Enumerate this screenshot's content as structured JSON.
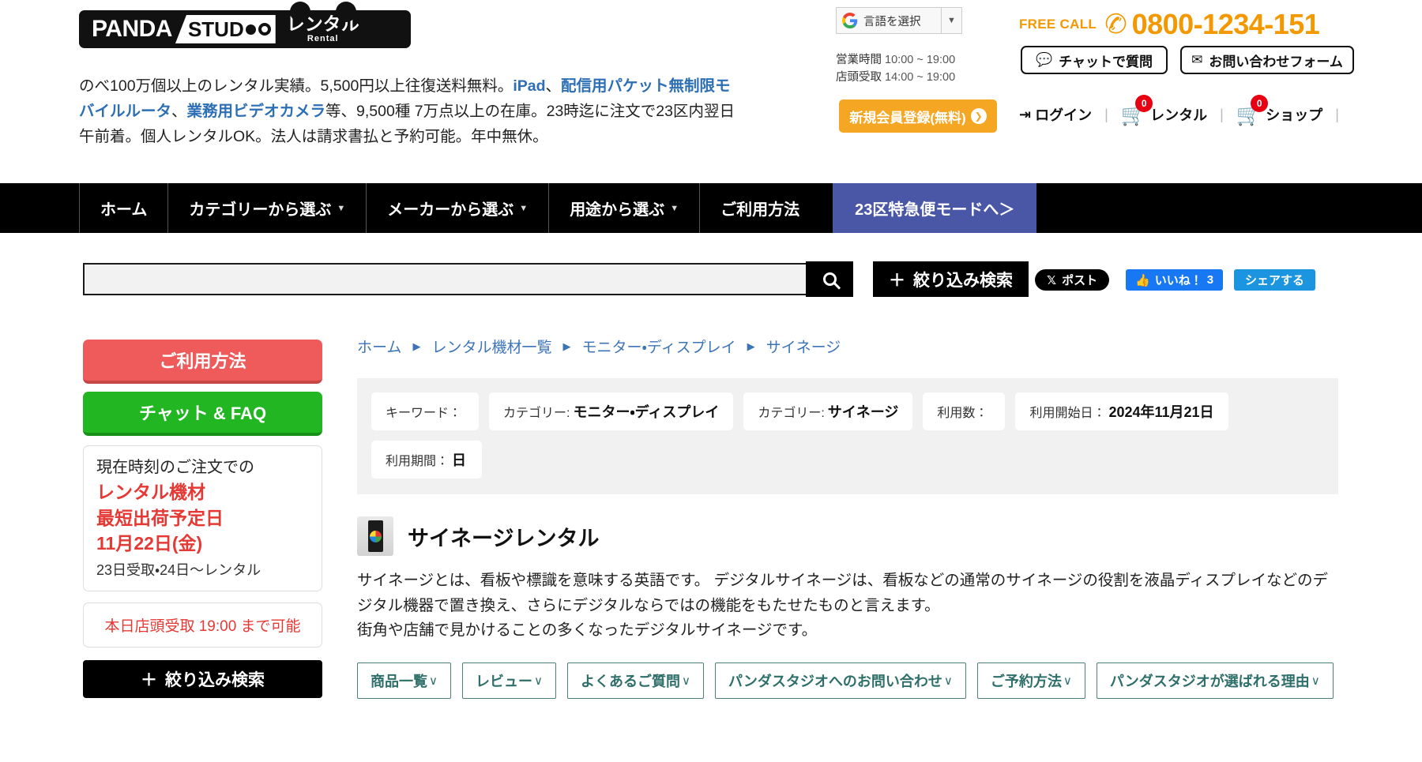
{
  "header": {
    "logo": {
      "panda": "PANDA",
      "studio": "STUD",
      "jp": "レンタル",
      "jp_sub": "Rental"
    },
    "intro_parts": {
      "p1": "のべ100万個以上のレンタル実績。5,500円以上往復送料無料。",
      "link1": "iPad",
      "sep1": "、",
      "link2": "配信用パケット無制限モバイルルータ",
      "sep2": "、",
      "link3": "業務用ビデオカメラ",
      "p2": "等、9,500種 7万点以上の在庫。23時迄に注文で23区内翌日午前着。個人レンタルOK。法人は請求書払と予約可能。年中無休。"
    },
    "language_select": {
      "label": "言語を選択",
      "caret": "▼",
      "icon": "google-g-icon"
    },
    "hours": [
      {
        "label": "営業時間",
        "value": "10:00 ~ 19:00"
      },
      {
        "label": "店頭受取",
        "value": "14:00 ~ 19:00"
      }
    ],
    "free_call": {
      "label": "FREE CALL",
      "number": "0800-1234-151",
      "icon": "phone-icon"
    },
    "chat_button": {
      "label": "チャットで質問",
      "icon": "chat-bubble-icon"
    },
    "contact_button": {
      "label": "お問い合わせフォーム",
      "icon": "envelope-icon"
    },
    "register_button": {
      "label": "新規会員登録(無料)",
      "arrow": "❯"
    },
    "account": {
      "login": {
        "label": "ログイン",
        "icon": "login-arrow-icon"
      },
      "rental_cart": {
        "label": "レンタル",
        "count": "0",
        "icon": "cart-icon"
      },
      "shop_cart": {
        "label": "ショップ",
        "count": "0",
        "icon": "cart-icon"
      },
      "separator": "|"
    }
  },
  "nav": {
    "items": [
      {
        "label": "ホーム",
        "has_caret": false
      },
      {
        "label": "カテゴリーから選ぶ",
        "has_caret": true
      },
      {
        "label": "メーカーから選ぶ",
        "has_caret": true
      },
      {
        "label": "用途から選ぶ",
        "has_caret": true
      },
      {
        "label": "ご利用方法",
        "has_caret": false
      }
    ],
    "caret": "▼",
    "highlight": "23区特急便モードへ＞"
  },
  "search": {
    "value": "",
    "placeholder": "",
    "go_icon": "search-icon",
    "refine_label": "絞り込み検索",
    "refine_plus": "＋"
  },
  "social": {
    "x_post": {
      "label": "ポスト",
      "icon": "x-logo-icon"
    },
    "fb_like": {
      "label": "いいね！",
      "count": "3",
      "icon": "thumbs-up-icon"
    },
    "fb_share": {
      "label": "シェアする"
    }
  },
  "sidebar": {
    "howto_button": "ご利用方法",
    "chat_faq_button": "チャット & FAQ",
    "shipping_card": {
      "line1": "現在時刻のご注文での",
      "line2": "レンタル機材",
      "line3": "最短出荷予定日",
      "line4": "11月22日(金)",
      "line5": "23日受取・24日〜レンタル"
    },
    "pickup_card": "本日店頭受取 19:00 まで可能",
    "refine_button": "絞り込み検索",
    "refine_plus": "＋"
  },
  "main": {
    "breadcrumb": [
      {
        "label": "ホーム"
      },
      {
        "label": "レンタル機材一覧"
      },
      {
        "label": "モニター・ディスプレイ"
      },
      {
        "label": "サイネージ"
      }
    ],
    "breadcrumb_sep": "▶",
    "filters": [
      {
        "label": "キーワード：",
        "value": ""
      },
      {
        "label": "カテゴリー:",
        "value": "モニター・ディスプレイ"
      },
      {
        "label": "カテゴリー:",
        "value": "サイネージ"
      },
      {
        "label": "利用数：",
        "value": ""
      },
      {
        "label": "利用開始日：",
        "value": "2024年11月21日"
      },
      {
        "label": "利用期間：",
        "value": "日"
      }
    ],
    "page_title": "サイネージレンタル",
    "title_icon": "signage-display-icon",
    "description": [
      "サイネージとは、看板や標識を意味する英語です。 デジタルサイネージは、看板などの通常のサイネージの役割を液晶ディスプレイなどのデジタル機器で置き換え、さらにデジタルならではの機能をもたせたものと言えます。",
      "街角や店舗で見かけることの多くなったデジタルサイネージです。"
    ],
    "tabs": [
      {
        "label": "商品一覧",
        "chev": "∨"
      },
      {
        "label": "レビュー",
        "chev": "∨"
      },
      {
        "label": "よくあるご質問",
        "chev": "∨"
      },
      {
        "label": "パンダスタジオへのお問い合わせ",
        "chev": "∨"
      },
      {
        "label": "ご予約方法",
        "chev": "∨"
      },
      {
        "label": "パンダスタジオが選ばれる理由",
        "chev": "∨"
      }
    ]
  },
  "colors": {
    "brand_orange": "#f39800",
    "nav_black": "#000000",
    "nav_highlight": "#4a56a6",
    "link_blue": "#2d6fb5",
    "red": "#e53935",
    "green": "#22b622",
    "teal": "#2f6f6a"
  }
}
